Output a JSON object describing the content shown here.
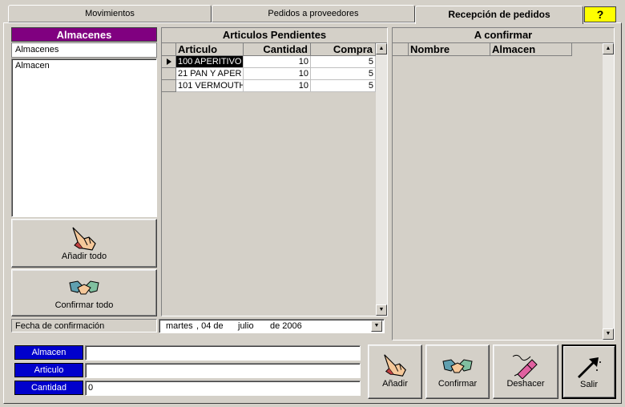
{
  "tabs": [
    {
      "label": "Movimientos"
    },
    {
      "label": "Pedidos a proveedores"
    },
    {
      "label": "Recepción de pedidos"
    }
  ],
  "help_label": "?",
  "almacenes": {
    "header": "Almacenes",
    "input_value": "Almacenes",
    "items": [
      "Almacen"
    ],
    "add_all_label": "Añadir todo",
    "confirm_all_label": "Confirmar todo"
  },
  "pendientes": {
    "header": "Articulos Pendientes",
    "columns": [
      "Articulo",
      "Cantidad",
      "Compra"
    ],
    "rows": [
      {
        "articulo": "100 APERITIVO",
        "cantidad": "10",
        "compra": "5"
      },
      {
        "articulo": "21 PAN Y APER",
        "cantidad": "10",
        "compra": "5"
      },
      {
        "articulo": "101 VERMOUTH",
        "cantidad": "10",
        "compra": "5"
      }
    ]
  },
  "confirmar": {
    "header": "A confirmar",
    "columns": [
      "Nombre",
      "Almacen"
    ]
  },
  "fecha": {
    "label": "Fecha de confirmación",
    "day": "martes",
    "date": ", 04 de",
    "month": "julio",
    "year": "de 2006"
  },
  "form": {
    "almacen_label": "Almacen",
    "almacen_value": "",
    "articulo_label": "Articulo",
    "articulo_value": "",
    "cantidad_label": "Cantidad",
    "cantidad_value": "0"
  },
  "buttons": {
    "anadir": "Añadir",
    "confirmar": "Confirmar",
    "deshacer": "Deshacer",
    "salir": "Salir"
  },
  "colors": {
    "purple_header": "#800080",
    "help_yellow": "#ffff00",
    "label_blue": "#0000cc",
    "selection": "#000000"
  }
}
